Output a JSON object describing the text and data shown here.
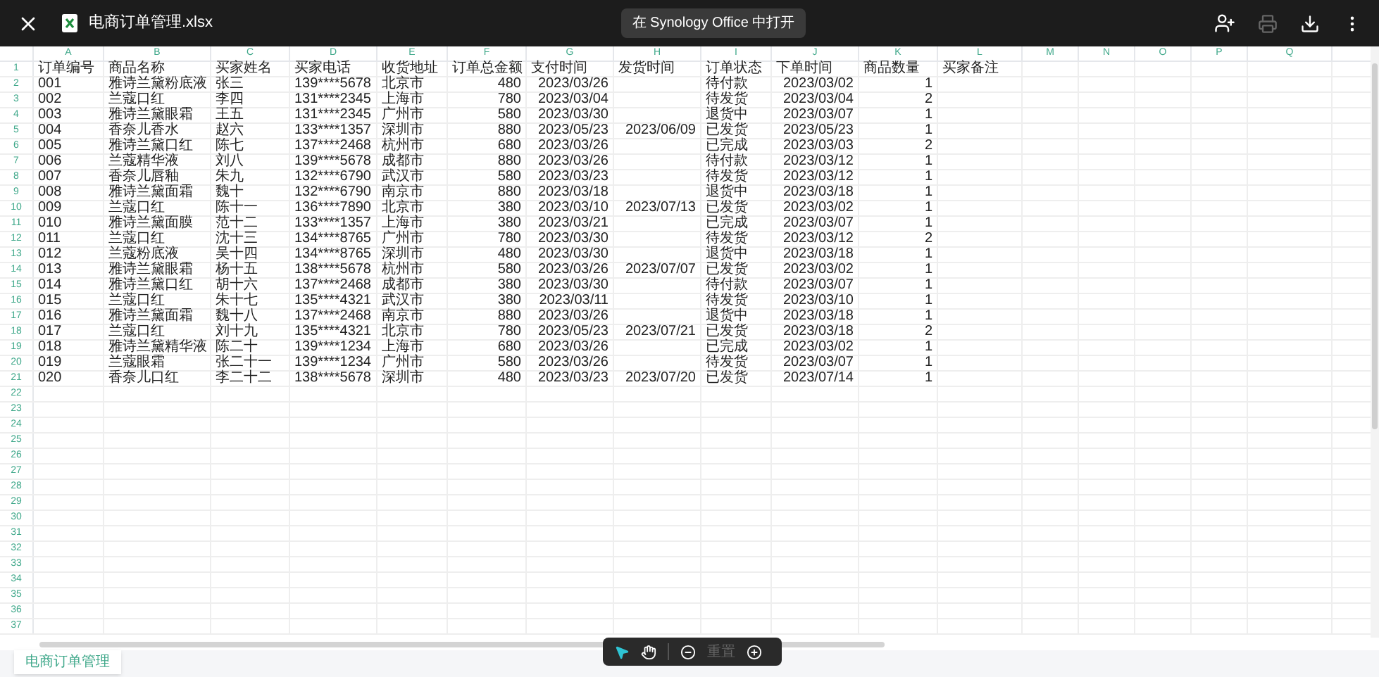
{
  "top_bar": {
    "file_name": "电商订单管理.xlsx",
    "open_button": "在 Synology Office 中打开",
    "print_disabled": true
  },
  "columns": [
    {
      "letter": "A",
      "kind": "text"
    },
    {
      "letter": "B",
      "kind": "text"
    },
    {
      "letter": "C",
      "kind": "text"
    },
    {
      "letter": "D",
      "kind": "text"
    },
    {
      "letter": "E",
      "kind": "text"
    },
    {
      "letter": "F",
      "kind": "number"
    },
    {
      "letter": "G",
      "kind": "number"
    },
    {
      "letter": "H",
      "kind": "number"
    },
    {
      "letter": "I",
      "kind": "text"
    },
    {
      "letter": "J",
      "kind": "number"
    },
    {
      "letter": "K",
      "kind": "number"
    },
    {
      "letter": "L",
      "kind": "text"
    },
    {
      "letter": "M",
      "kind": "text"
    },
    {
      "letter": "N",
      "kind": "text"
    },
    {
      "letter": "O",
      "kind": "text"
    },
    {
      "letter": "P",
      "kind": "text"
    },
    {
      "letter": "Q",
      "kind": "text"
    }
  ],
  "rows": [
    {
      "number": "1",
      "kind": "header",
      "cells": [
        "订单编号",
        "商品名称",
        "买家姓名",
        "买家电话",
        "收货地址",
        "订单总金额",
        "支付时间",
        "发货时间",
        "订单状态",
        "下单时间",
        "商品数量",
        "买家备注"
      ]
    },
    {
      "number": "2",
      "kind": "data",
      "cells": [
        "001",
        "雅诗兰黛粉底液",
        "张三",
        "139****5678",
        "北京市",
        "480",
        "2023/03/26",
        null,
        "待付款",
        "2023/03/02",
        "1"
      ]
    },
    {
      "number": "3",
      "kind": "data",
      "cells": [
        "002",
        "兰蔻口红",
        "李四",
        "131****2345",
        "上海市",
        "780",
        "2023/03/04",
        null,
        "待发货",
        "2023/03/04",
        "2"
      ]
    },
    {
      "number": "4",
      "kind": "data",
      "cells": [
        "003",
        "雅诗兰黛眼霜",
        "王五",
        "131****2345",
        "广州市",
        "580",
        "2023/03/30",
        null,
        "退货中",
        "2023/03/07",
        "1"
      ]
    },
    {
      "number": "5",
      "kind": "data",
      "cells": [
        "004",
        "香奈儿香水",
        "赵六",
        "133****1357",
        "深圳市",
        "880",
        "2023/05/23",
        "2023/06/09",
        "已发货",
        "2023/05/23",
        "1"
      ]
    },
    {
      "number": "6",
      "kind": "data",
      "cells": [
        "005",
        "雅诗兰黛口红",
        "陈七",
        "137****2468",
        "杭州市",
        "680",
        "2023/03/26",
        null,
        "已完成",
        "2023/03/03",
        "2"
      ]
    },
    {
      "number": "7",
      "kind": "data",
      "cells": [
        "006",
        "兰蔻精华液",
        "刘八",
        "139****5678",
        "成都市",
        "880",
        "2023/03/26",
        null,
        "待付款",
        "2023/03/12",
        "1"
      ]
    },
    {
      "number": "8",
      "kind": "data",
      "cells": [
        "007",
        "香奈儿唇釉",
        "朱九",
        "132****6790",
        "武汉市",
        "580",
        "2023/03/23",
        null,
        "待发货",
        "2023/03/12",
        "1"
      ]
    },
    {
      "number": "9",
      "kind": "data",
      "cells": [
        "008",
        "雅诗兰黛面霜",
        "魏十",
        "132****6790",
        "南京市",
        "880",
        "2023/03/18",
        null,
        "退货中",
        "2023/03/18",
        "1"
      ]
    },
    {
      "number": "10",
      "kind": "data",
      "cells": [
        "009",
        "兰蔻口红",
        "陈十一",
        "136****7890",
        "北京市",
        "380",
        "2023/03/10",
        "2023/07/13",
        "已发货",
        "2023/03/02",
        "1"
      ]
    },
    {
      "number": "11",
      "kind": "data",
      "cells": [
        "010",
        "雅诗兰黛面膜",
        "范十二",
        "133****1357",
        "上海市",
        "380",
        "2023/03/21",
        null,
        "已完成",
        "2023/03/07",
        "1"
      ]
    },
    {
      "number": "12",
      "kind": "data",
      "cells": [
        "011",
        "兰蔻口红",
        "沈十三",
        "134****8765",
        "广州市",
        "780",
        "2023/03/30",
        null,
        "待发货",
        "2023/03/12",
        "2"
      ]
    },
    {
      "number": "13",
      "kind": "data",
      "cells": [
        "012",
        "兰蔻粉底液",
        "吴十四",
        "134****8765",
        "深圳市",
        "480",
        "2023/03/30",
        null,
        "退货中",
        "2023/03/18",
        "1"
      ]
    },
    {
      "number": "14",
      "kind": "data",
      "cells": [
        "013",
        "雅诗兰黛眼霜",
        "杨十五",
        "138****5678",
        "杭州市",
        "580",
        "2023/03/26",
        "2023/07/07",
        "已发货",
        "2023/03/02",
        "1"
      ]
    },
    {
      "number": "15",
      "kind": "data",
      "cells": [
        "014",
        "雅诗兰黛口红",
        "胡十六",
        "137****2468",
        "成都市",
        "380",
        "2023/03/30",
        null,
        "待付款",
        "2023/03/07",
        "1"
      ]
    },
    {
      "number": "16",
      "kind": "data",
      "cells": [
        "015",
        "兰蔻口红",
        "朱十七",
        "135****4321",
        "武汉市",
        "380",
        "2023/03/11",
        null,
        "待发货",
        "2023/03/10",
        "1"
      ]
    },
    {
      "number": "17",
      "kind": "data",
      "cells": [
        "016",
        "雅诗兰黛面霜",
        "魏十八",
        "137****2468",
        "南京市",
        "880",
        "2023/03/26",
        null,
        "退货中",
        "2023/03/18",
        "1"
      ]
    },
    {
      "number": "18",
      "kind": "data",
      "cells": [
        "017",
        "兰蔻口红",
        "刘十九",
        "135****4321",
        "北京市",
        "780",
        "2023/05/23",
        "2023/07/21",
        "已发货",
        "2023/03/18",
        "2"
      ]
    },
    {
      "number": "19",
      "kind": "data",
      "cells": [
        "018",
        "雅诗兰黛精华液",
        "陈二十",
        "139****1234",
        "上海市",
        "680",
        "2023/03/26",
        null,
        "已完成",
        "2023/03/02",
        "1"
      ]
    },
    {
      "number": "20",
      "kind": "data",
      "cells": [
        "019",
        "兰蔻眼霜",
        "张二十一",
        "139****1234",
        "广州市",
        "580",
        "2023/03/26",
        null,
        "待发货",
        "2023/03/07",
        "1"
      ]
    },
    {
      "number": "21",
      "kind": "data",
      "cells": [
        "020",
        "香奈儿口红",
        "李二十二",
        "138****5678",
        "深圳市",
        "480",
        "2023/03/23",
        "2023/07/20",
        "已发货",
        "2023/07/14",
        "1"
      ]
    },
    {
      "number": "22"
    },
    {
      "number": "23"
    },
    {
      "number": "24"
    },
    {
      "number": "25"
    },
    {
      "number": "26"
    },
    {
      "number": "27"
    },
    {
      "number": "28"
    },
    {
      "number": "29"
    },
    {
      "number": "30"
    },
    {
      "number": "31"
    },
    {
      "number": "32"
    },
    {
      "number": "33"
    },
    {
      "number": "34"
    },
    {
      "number": "35"
    },
    {
      "number": "36"
    },
    {
      "number": "37"
    }
  ],
  "sheet_tabs": [
    {
      "label": "电商订单管理",
      "selected": true
    }
  ],
  "zoom_toolbar": {
    "tools": [
      {
        "kind": "pointer",
        "selected": true
      },
      {
        "kind": "hand",
        "selected": false
      }
    ],
    "reset": {
      "label": "重置",
      "disabled": true
    }
  }
}
